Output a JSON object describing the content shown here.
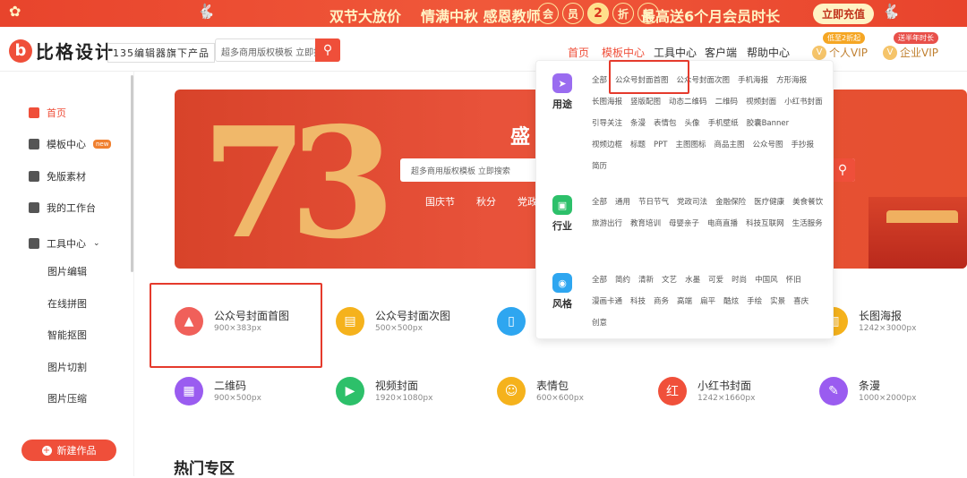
{
  "banner": {
    "t1": "双节大放价",
    "t2": "情满中秋 感恩教师",
    "pill": [
      "会",
      "员",
      "2",
      "折",
      "起"
    ],
    "t3": "最高送6个月会员时长",
    "cta": "立即充值"
  },
  "logo": {
    "mark": "b",
    "name": "比格设计"
  },
  "tagline": "135编辑器旗下产品",
  "search": {
    "placeholder": "超多商用版权模板 立即搜索"
  },
  "topnav": {
    "home": "首页",
    "templates": "模板中心",
    "tools": "工具中心",
    "client": "客户端",
    "help": "帮助中心",
    "vip_badge": "低至2折起",
    "vip": "个人VIP",
    "ent_badge": "送半年时长",
    "ent": "企业VIP"
  },
  "sidebar": {
    "items": [
      {
        "label": "首页",
        "icon": "home-icon"
      },
      {
        "label": "模板中心",
        "icon": "grid-icon",
        "hot": "new"
      },
      {
        "label": "免版素材",
        "icon": "file-icon"
      },
      {
        "label": "我的工作台",
        "icon": "monitor-icon"
      },
      {
        "label": "工具中心",
        "icon": "toolbox-icon"
      }
    ],
    "subitems": [
      "图片编辑",
      "在线拼图",
      "智能抠图",
      "图片切割",
      "图片压缩"
    ],
    "new_button": "新建作品"
  },
  "hero": {
    "number": "73",
    "title": "盛",
    "search_placeholder": "超多商用版权模板 立即搜索",
    "tags": [
      "国庆节",
      "秋分",
      "党政"
    ]
  },
  "categories": [
    {
      "name": "公众号封面首图",
      "size": "900×383px",
      "color": "#f0605a",
      "icon": "image-icon"
    },
    {
      "name": "公众号封面次图",
      "size": "500×500px",
      "color": "#f5b21c",
      "icon": "doc-icon"
    },
    {
      "name": "",
      "size": "",
      "color": "#2ea6f0",
      "icon": "phone-icon"
    },
    {
      "name": "长图海报",
      "size": "1242×3000px",
      "color": "#f5b21c",
      "icon": "poster-icon"
    },
    {
      "name": "二维码",
      "size": "900×500px",
      "color": "#9a5cf0",
      "icon": "qrcode-icon"
    },
    {
      "name": "视频封面",
      "size": "1920×1080px",
      "color": "#2dc06a",
      "icon": "video-icon"
    },
    {
      "name": "表情包",
      "size": "600×600px",
      "color": "#f5b21c",
      "icon": "smile-icon"
    },
    {
      "name": "小红书封面",
      "size": "1242×1660px",
      "color": "#f0503a",
      "icon": "redbook-icon"
    },
    {
      "name": "条漫",
      "size": "1000×2000px",
      "color": "#9a5cf0",
      "icon": "brush-icon"
    }
  ],
  "hot_section": "热门专区",
  "dropdown": {
    "groups": [
      {
        "label": "用途",
        "color": "#9a6cf0",
        "icon": "send-icon",
        "items": [
          "全部",
          "公众号封面首图",
          "公众号封面次图",
          "手机海报",
          "方形海报",
          "长图海报",
          "竖版配图",
          "动态二维码",
          "二维码",
          "视频封面",
          "小红书封面",
          "引导关注",
          "条漫",
          "表情包",
          "头像",
          "手机壁纸",
          "胶囊Banner",
          "视频边框",
          "标题",
          "PPT",
          "主图图标",
          "商品主图",
          "公众号图",
          "手抄报",
          "简历"
        ]
      },
      {
        "label": "行业",
        "color": "#2dc06a",
        "icon": "briefcase-icon",
        "items": [
          "全部",
          "通用",
          "节日节气",
          "党政司法",
          "金融保险",
          "医疗健康",
          "美食餐饮",
          "旅游出行",
          "教育培训",
          "母婴亲子",
          "电商直播",
          "科技互联网",
          "生活服务"
        ]
      },
      {
        "label": "风格",
        "color": "#2ea6f0",
        "icon": "palette-icon",
        "items": [
          "全部",
          "简约",
          "清新",
          "文艺",
          "水墨",
          "可爱",
          "时尚",
          "中国风",
          "怀旧",
          "漫画卡通",
          "科技",
          "商务",
          "高端",
          "扁平",
          "酷炫",
          "手绘",
          "实景",
          "喜庆",
          "创意"
        ]
      }
    ]
  }
}
